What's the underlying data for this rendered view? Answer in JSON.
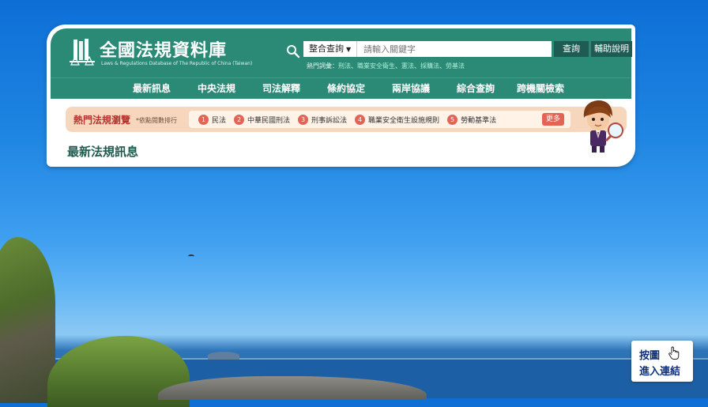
{
  "site": {
    "title": "全國法規資料庫",
    "subtitle": "Laws & Regulations Database of The Republic of China (Taiwan)"
  },
  "search": {
    "scope_selected": "整合查詢",
    "placeholder": "請輸入關鍵字",
    "search_button": "查詢",
    "help_button": "輔助說明",
    "hot_label": "熱門詞彙：",
    "hot_keywords": [
      "刑法",
      "職業安全衛生",
      "憲法",
      "採購法",
      "勞基法"
    ]
  },
  "nav": {
    "items": [
      "最新訊息",
      "中央法規",
      "司法解釋",
      "條約協定",
      "兩岸協議",
      "綜合查詢",
      "跨機關檢索"
    ]
  },
  "hot_laws": {
    "title": "熱門法規瀏覽",
    "note": "*依點閱數排行",
    "items": [
      {
        "rank": "1",
        "label": "民法"
      },
      {
        "rank": "2",
        "label": "中華民國刑法"
      },
      {
        "rank": "3",
        "label": "刑事訴訟法"
      },
      {
        "rank": "4",
        "label": "職業安全衛生設施規則"
      },
      {
        "rank": "5",
        "label": "勞動基準法"
      }
    ],
    "more_button": "更多"
  },
  "news": {
    "heading": "最新法規訊息"
  },
  "click_hint": {
    "line1": "按圖",
    "line2": "進入連結"
  },
  "colors": {
    "header_green": "#2a8a76",
    "button_dark_green": "#1e5c53",
    "accent_red": "#e36455",
    "hotbar_bg": "#f6d7bd"
  }
}
